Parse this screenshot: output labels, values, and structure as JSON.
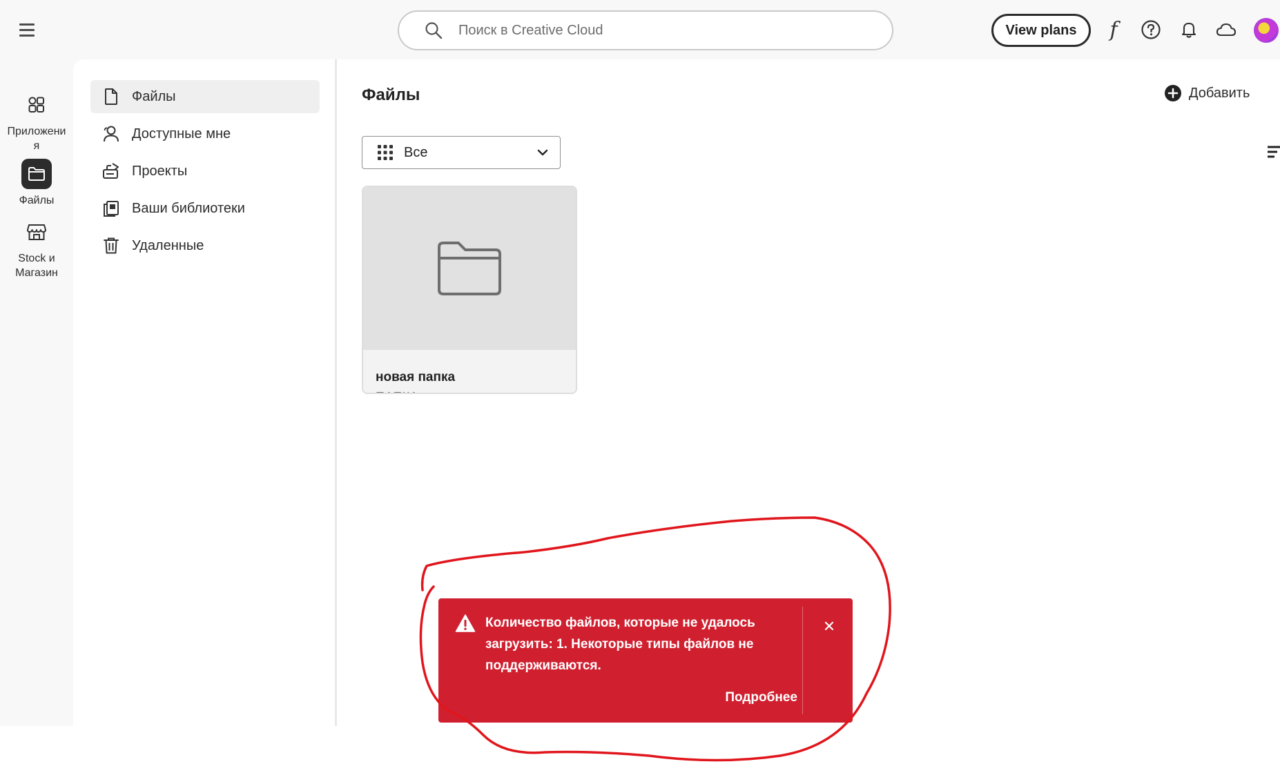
{
  "topbar": {
    "search_placeholder": "Поиск в Creative Cloud",
    "view_plans_label": "View plans",
    "font_glyph": "f"
  },
  "rail": {
    "items": [
      {
        "label": "Приложени\nя",
        "icon": "apps-icon"
      },
      {
        "label": "Файлы",
        "icon": "folder-icon",
        "active": true
      },
      {
        "label": "Stock и Магазин",
        "icon": "store-icon"
      }
    ]
  },
  "subnav": {
    "items": [
      {
        "label": "Файлы",
        "icon": "file-icon",
        "active": true
      },
      {
        "label": "Доступные мне",
        "icon": "shared-users-icon"
      },
      {
        "label": "Проекты",
        "icon": "projects-icon"
      },
      {
        "label": "Ваши библиотеки",
        "icon": "libraries-icon"
      },
      {
        "label": "Удаленные",
        "icon": "trash-icon"
      }
    ]
  },
  "main": {
    "title": "Файлы",
    "add_label": "Добавить",
    "filter_value": "Все",
    "cards": [
      {
        "title": "новая папка",
        "type": "ПАПКА",
        "icon": "folder-icon"
      }
    ]
  },
  "toast": {
    "message": "Количество файлов, которые не удалось загрузить: 1. Некоторые типы файлов не поддерживаются.",
    "more_label": "Подробнее",
    "color": "#d02030"
  },
  "colors": {
    "annotation": "#e0161c",
    "accent_dark": "#2c2c2c"
  }
}
